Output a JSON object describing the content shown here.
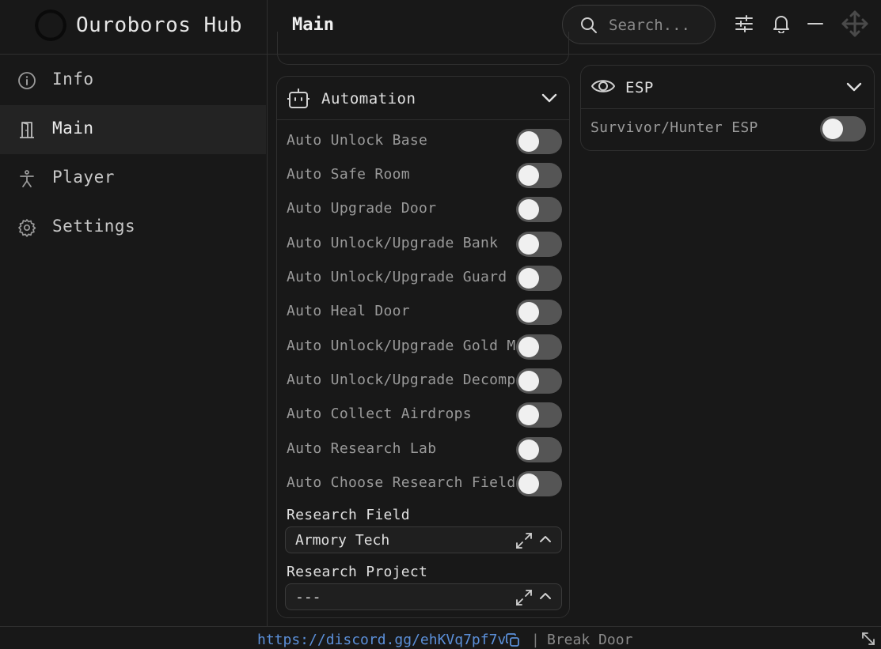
{
  "app": {
    "title": "Ouroboros Hub",
    "page_title": "Main"
  },
  "search": {
    "placeholder": "Search..."
  },
  "toolbar": {
    "icons": [
      "sliders-icon",
      "bell-icon",
      "minimize-icon",
      "move-icon"
    ]
  },
  "sidebar": {
    "items": [
      {
        "label": "Info",
        "icon": "info-icon",
        "active": false
      },
      {
        "label": "Main",
        "icon": "door-icon",
        "active": true
      },
      {
        "label": "Player",
        "icon": "person-icon",
        "active": false
      },
      {
        "label": "Settings",
        "icon": "gear-icon",
        "active": false
      }
    ]
  },
  "automation": {
    "title": "Automation",
    "toggles": [
      {
        "label": "Auto Unlock Base",
        "on": false
      },
      {
        "label": "Auto Safe Room",
        "on": false
      },
      {
        "label": "Auto Upgrade Door",
        "on": false
      },
      {
        "label": "Auto Unlock/Upgrade Bank",
        "on": false
      },
      {
        "label": "Auto Unlock/Upgrade Guard",
        "on": false
      },
      {
        "label": "Auto Heal Door",
        "on": false
      },
      {
        "label": "Auto Unlock/Upgrade Gold Machine",
        "on": false
      },
      {
        "label": "Auto Unlock/Upgrade Decomposer",
        "on": false
      },
      {
        "label": "Auto Collect Airdrops",
        "on": false
      },
      {
        "label": "Auto Research Lab",
        "on": false
      },
      {
        "label": "Auto Choose Research Field",
        "on": false
      }
    ],
    "research_field": {
      "label": "Research Field",
      "value": "Armory Tech"
    },
    "research_project": {
      "label": "Research Project",
      "value": "---"
    }
  },
  "esp": {
    "title": "ESP",
    "toggles": [
      {
        "label": "Survivor/Hunter ESP",
        "on": false
      }
    ]
  },
  "footer": {
    "link": "https://discord.gg/ehKVq7pf7v",
    "separator": "|",
    "status": "Break Door"
  },
  "colors": {
    "background": "#181818",
    "border": "#2f2f2f",
    "link": "#5b8fd8",
    "toggle_off": "#555555"
  }
}
